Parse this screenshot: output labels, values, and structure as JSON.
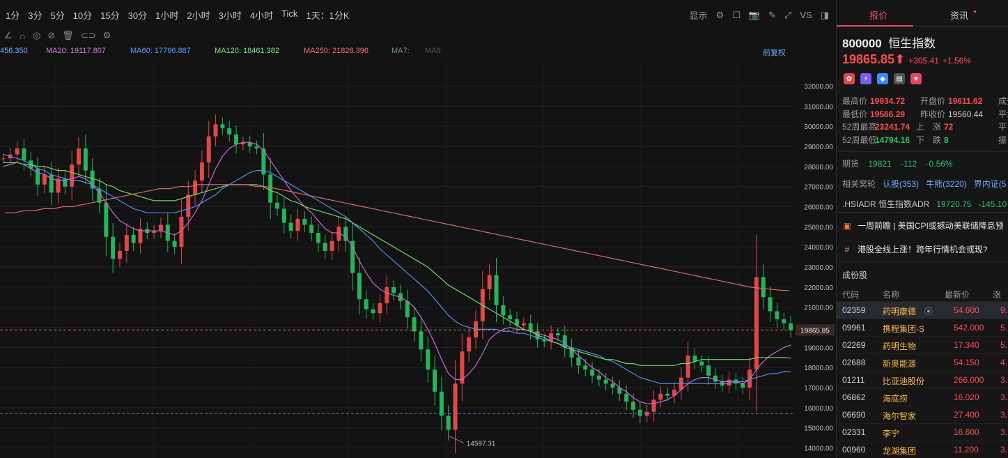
{
  "toolbar": {
    "periods": [
      "1分",
      "3分",
      "5分",
      "10分",
      "15分",
      "30分",
      "1小时",
      "2小时",
      "3小时",
      "4小时",
      "Tick",
      "1天：1分K"
    ],
    "display_label": "显示",
    "vs_label": "VS"
  },
  "indicators": [
    {
      "text": "456.350",
      "color": "#6fb3ff"
    },
    {
      "text": "MA20: 19117.807",
      "color": "#d27be0"
    },
    {
      "text": "MA60: 17796.887",
      "color": "#5b9cff"
    },
    {
      "text": "MA120: 18461.382",
      "color": "#7ce37c"
    },
    {
      "text": "MA250: 21828.396",
      "color": "#ff6b6b"
    },
    {
      "text": "MA7:",
      "color": "#6f8fa0"
    },
    {
      "text": "MA8:",
      "color": "#555"
    }
  ],
  "chart_meta": {
    "adjust_label": "前复权",
    "current_price_label": "19865.85",
    "low_label": "14597.31"
  },
  "chart_data": {
    "type": "line",
    "y_ticks": [
      32000,
      31000,
      30000,
      29000,
      28000,
      27000,
      26000,
      25000,
      24000,
      23000,
      22000,
      21000,
      20000,
      19000,
      18000,
      17000,
      16000,
      15000,
      14000
    ],
    "ylim": [
      13500,
      33300
    ],
    "current_price": 19865.85,
    "low_marker": 14597.31,
    "reference_line": 15700,
    "close_series": [
      28400,
      28600,
      28900,
      28300,
      27900,
      27100,
      27600,
      26700,
      27400,
      27000,
      28100,
      28900,
      27800,
      26900,
      26200,
      24500,
      23400,
      23800,
      24600,
      24200,
      24900,
      24700,
      24800,
      25100,
      24300,
      24000,
      25500,
      26600,
      27300,
      28200,
      29500,
      30100,
      29900,
      29600,
      29100,
      29200,
      29000,
      28900,
      27600,
      26200,
      25900,
      25200,
      24800,
      25400,
      25100,
      24700,
      24200,
      23800,
      24300,
      25000,
      24300,
      22700,
      21400,
      20900,
      20700,
      21200,
      22000,
      21700,
      21300,
      20500,
      19800,
      18900,
      17900,
      16800,
      15600,
      14900,
      17200,
      18800,
      19500,
      20300,
      21900,
      22600,
      21100,
      20600,
      20400,
      20100,
      20200,
      19800,
      19400,
      19300,
      19700,
      19600,
      19000,
      18500,
      18100,
      17900,
      17600,
      17400,
      17200,
      17000,
      16700,
      16300,
      15900,
      15600,
      15800,
      16400,
      16700,
      16600,
      16900,
      17500,
      18600,
      18300,
      18100,
      17600,
      17300,
      17100,
      17400,
      17200,
      17000,
      17900,
      22500,
      21500,
      20800,
      20400,
      20200,
      19865
    ],
    "series": [
      {
        "name": "MA20",
        "values": [
          28000,
          28100,
          28200,
          28100,
          27900,
          27700,
          27600,
          27400,
          27300,
          27300,
          27400,
          27500,
          27400,
          27100,
          26700,
          26200,
          25700,
          25300,
          25100,
          24900,
          24800,
          24800,
          24800,
          24800,
          24700,
          24600,
          24800,
          25200,
          25700,
          26300,
          27100,
          27900,
          28500,
          28900,
          29100,
          29200,
          29200,
          29100,
          28800,
          28300,
          27800,
          27300,
          26800,
          26400,
          26000,
          25700,
          25300,
          24900,
          24700,
          24700,
          24500,
          24000,
          23300,
          22700,
          22200,
          21900,
          21700,
          21600,
          21500,
          21300,
          21000,
          20500,
          19900,
          19200,
          18400,
          17700,
          17400,
          17400,
          17700,
          18100,
          18700,
          19400,
          19700,
          19900,
          20000,
          19900,
          19900,
          19800,
          19700,
          19600,
          19500,
          19400,
          19200,
          18900,
          18600,
          18300,
          18000,
          17800,
          17500,
          17300,
          17000,
          16800,
          16500,
          16300,
          16200,
          16200,
          16300,
          16400,
          16600,
          16900,
          17200,
          17400,
          17500,
          17500,
          17400,
          17300,
          17300,
          17300,
          17200,
          17400,
          17900,
          18300,
          18600,
          18800,
          19000,
          19117
        ]
      },
      {
        "name": "MA60",
        "values": [
          28600,
          28500,
          28400,
          28300,
          28100,
          27900,
          27800,
          27600,
          27500,
          27400,
          27300,
          27300,
          27200,
          27100,
          26900,
          26700,
          26500,
          26300,
          26100,
          25900,
          25800,
          25700,
          25700,
          25700,
          25700,
          25700,
          25800,
          25900,
          26000,
          26200,
          26400,
          26600,
          26900,
          27100,
          27300,
          27500,
          27700,
          27800,
          27800,
          27700,
          27500,
          27300,
          27100,
          26900,
          26700,
          26500,
          26300,
          26100,
          25900,
          25700,
          25500,
          25200,
          24900,
          24600,
          24300,
          23900,
          23600,
          23300,
          23000,
          22700,
          22400,
          22100,
          21800,
          21400,
          21000,
          20600,
          20300,
          20100,
          20000,
          19900,
          19900,
          19900,
          19900,
          19800,
          19800,
          19700,
          19700,
          19600,
          19500,
          19400,
          19300,
          19200,
          19100,
          19000,
          18900,
          18800,
          18700,
          18600,
          18400,
          18300,
          18100,
          17900,
          17700,
          17500,
          17400,
          17300,
          17200,
          17200,
          17200,
          17200,
          17200,
          17200,
          17200,
          17200,
          17200,
          17200,
          17200,
          17300,
          17300,
          17400,
          17500,
          17600,
          17700,
          17700,
          17800,
          17797
        ]
      },
      {
        "name": "MA120",
        "values": [
          28200,
          28200,
          28200,
          28100,
          28100,
          28000,
          28000,
          27900,
          27800,
          27800,
          27700,
          27600,
          27500,
          27400,
          27300,
          27100,
          27000,
          26800,
          26700,
          26600,
          26500,
          26400,
          26300,
          26300,
          26300,
          26300,
          26400,
          26500,
          26600,
          26700,
          26800,
          26900,
          27000,
          27100,
          27100,
          27100,
          27100,
          27100,
          27000,
          26800,
          26700,
          26500,
          26300,
          26200,
          26000,
          25900,
          25800,
          25700,
          25600,
          25500,
          25400,
          25200,
          25000,
          24800,
          24600,
          24400,
          24200,
          24000,
          23800,
          23600,
          23400,
          23200,
          23000,
          22700,
          22400,
          22100,
          21900,
          21700,
          21500,
          21300,
          21100,
          20900,
          20700,
          20500,
          20300,
          20100,
          19900,
          19800,
          19600,
          19500,
          19300,
          19200,
          19000,
          18900,
          18800,
          18700,
          18600,
          18500,
          18400,
          18400,
          18300,
          18200,
          18200,
          18100,
          18100,
          18100,
          18100,
          18100,
          18100,
          18200,
          18200,
          18300,
          18400,
          18400,
          18400,
          18400,
          18400,
          18400,
          18400,
          18400,
          18500,
          18500,
          18500,
          18500,
          18500,
          18461
        ]
      },
      {
        "name": "MA250",
        "values": [
          25700,
          25700,
          25800,
          25800,
          25900,
          25900,
          26000,
          26000,
          26100,
          26200,
          26300,
          26400,
          26500,
          26600,
          26700,
          26800,
          26900,
          26900,
          27000,
          27000,
          27100,
          27100,
          27100,
          27100,
          27100,
          27100,
          27000,
          27000,
          26900,
          26800,
          26700,
          26600,
          26500,
          26400,
          26300,
          26200,
          26100,
          26000,
          25900,
          25800,
          25700,
          25600,
          25500,
          25400,
          25300,
          25200,
          25100,
          25000,
          24900,
          24800,
          24700,
          24600,
          24500,
          24400,
          24300,
          24200,
          24100,
          24000,
          23900,
          23800,
          23700,
          23600,
          23500,
          23400,
          23300,
          23200,
          23100,
          23000,
          22900,
          22800,
          22700,
          22600,
          22500,
          22400,
          22300,
          22200,
          22100,
          22000,
          21950,
          21900,
          21850,
          21828
        ]
      }
    ]
  },
  "panel": {
    "tabs": [
      "报价",
      "资讯"
    ],
    "code": "800000",
    "name": "恒生指数",
    "price": "19865.85",
    "change": "+305.41",
    "change_pct": "+1.56%",
    "stats": [
      {
        "l1": "最高价",
        "v1": "19934.72",
        "c1": "r",
        "l2": "开盘价",
        "v2": "19611.62",
        "c2": "r",
        "l3": "成交"
      },
      {
        "l1": "最低价",
        "v1": "19566.29",
        "c1": "r",
        "l2": "昨收价",
        "v2": "19560.44",
        "c2": "",
        "l3": "平均"
      },
      {
        "l1": "52周最高",
        "v1": "23241.74",
        "c1": "r",
        "l2": "上　涨",
        "v2": "72",
        "c2": "r",
        "l3": "平"
      },
      {
        "l1": "52周最低",
        "v1": "14794.16",
        "c1": "g",
        "l2": "下　跌",
        "v2": "8",
        "c2": "g",
        "l3": "振"
      }
    ],
    "futures_label": "期货",
    "futures_price": "19821",
    "futures_change": "-112",
    "futures_pct": "-0.56%",
    "warrants_label": "相关窝轮",
    "warrants_call": "认股(353)",
    "warrants_bull": "牛熊(3220)",
    "warrants_inline": "界内证(5",
    "adr_label": ".HSIADR 恒生指数ADR",
    "adr_price": "19720.75",
    "adr_change": "-145.10",
    "news1": "一周前瞻 | 美国CPI或撼动美联储降息预",
    "news2": "港股全线上涨！跨年行情机会或现?",
    "constituents_title": "成份股",
    "table_headers": [
      "代码",
      "名称",
      "最新价",
      "涨跌"
    ],
    "rows": [
      {
        "code": "02359",
        "name": "药明康德",
        "price": "54.600",
        "chg": "9."
      },
      {
        "code": "09961",
        "name": "携程集团-S",
        "price": "542.000",
        "chg": "5."
      },
      {
        "code": "02269",
        "name": "药明生物",
        "price": "17.340",
        "chg": "5."
      },
      {
        "code": "02688",
        "name": "新奥能源",
        "price": "54.150",
        "chg": "4."
      },
      {
        "code": "01211",
        "name": "比亚迪股份",
        "price": "266.000",
        "chg": "3."
      },
      {
        "code": "06862",
        "name": "海底捞",
        "price": "16.020",
        "chg": "3."
      },
      {
        "code": "06690",
        "name": "海尔智家",
        "price": "27.400",
        "chg": "3."
      },
      {
        "code": "02331",
        "name": "李宁",
        "price": "16.600",
        "chg": "3."
      },
      {
        "code": "00960",
        "name": "龙湖集团",
        "price": "11.200",
        "chg": "3."
      }
    ]
  }
}
